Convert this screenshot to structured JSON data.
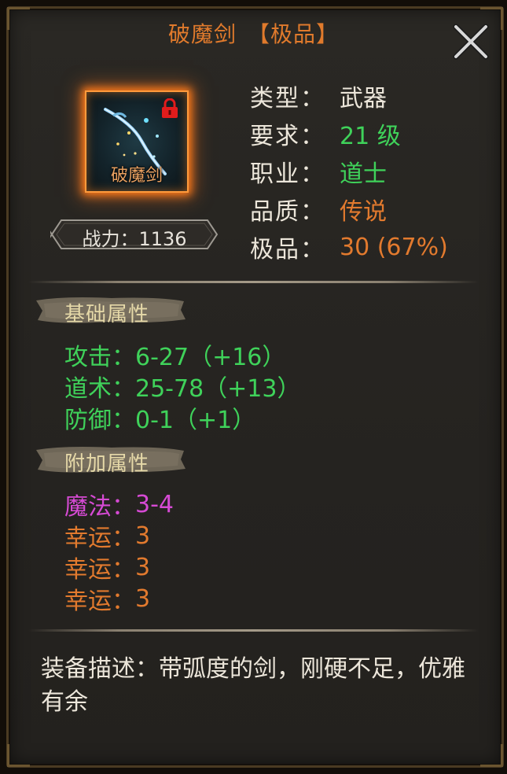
{
  "item": {
    "name": "破魔剑",
    "grade": "【极品】",
    "icon_label": "破魔剑",
    "locked": true,
    "power_label": "战力：",
    "power_value": "1136"
  },
  "info": [
    {
      "label": "类型：",
      "value": "武器",
      "color": "white"
    },
    {
      "label": "要求：",
      "value": "21 级",
      "color": "green"
    },
    {
      "label": "职业：",
      "value": "道士",
      "color": "green"
    },
    {
      "label": "品质：",
      "value": "传说",
      "color": "orange"
    },
    {
      "label": "极品：",
      "value": "30 (67%)",
      "color": "orange"
    }
  ],
  "base_section": {
    "title": "基础属性",
    "attrs": [
      {
        "label": "攻击：",
        "value": "6-27（+16）",
        "color": "green"
      },
      {
        "label": "道术：",
        "value": "25-78（+13）",
        "color": "green"
      },
      {
        "label": "防御：",
        "value": "0-1（+1）",
        "color": "green"
      }
    ]
  },
  "extra_section": {
    "title": "附加属性",
    "attrs": [
      {
        "label": "魔法：",
        "value": "3-4",
        "color": "magenta"
      },
      {
        "label": "幸运：",
        "value": "3",
        "color": "orange"
      },
      {
        "label": "幸运：",
        "value": "3",
        "color": "orange"
      },
      {
        "label": "幸运：",
        "value": "3",
        "color": "orange"
      }
    ]
  },
  "description": {
    "label": "装备描述：",
    "text": "带弧度的剑，刚硬不足，优雅有余"
  },
  "icons": {
    "close": "close-icon",
    "lock": "lock-icon",
    "weapon": "sword-icon"
  },
  "colors": {
    "title": "#e07a2c",
    "green": "#3fd25a",
    "orange": "#e27a2e",
    "magenta": "#d64ad4",
    "white": "#ece6da",
    "section_text": "#e6d9a8",
    "frame_glow": "#ff7a1a"
  }
}
